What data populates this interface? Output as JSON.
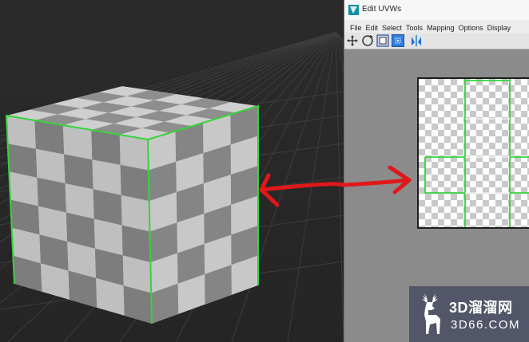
{
  "uvw_window": {
    "title": "Edit UVWs",
    "menus": [
      "File",
      "Edit",
      "Select",
      "Tools",
      "Mapping",
      "Options",
      "Display"
    ],
    "toolbar_icons": [
      "move-icon",
      "rotate-icon",
      "scale-icon",
      "freeform-icon",
      "mirror-icon"
    ]
  },
  "watermark": {
    "main": "3D溜溜网",
    "sub": "3D66.COM"
  },
  "colors": {
    "seam": "#35d43a",
    "arrow": "#e0181b",
    "viewport_bg": "#2a2a2a",
    "uv_editor_bg": "#8b8b8b"
  }
}
